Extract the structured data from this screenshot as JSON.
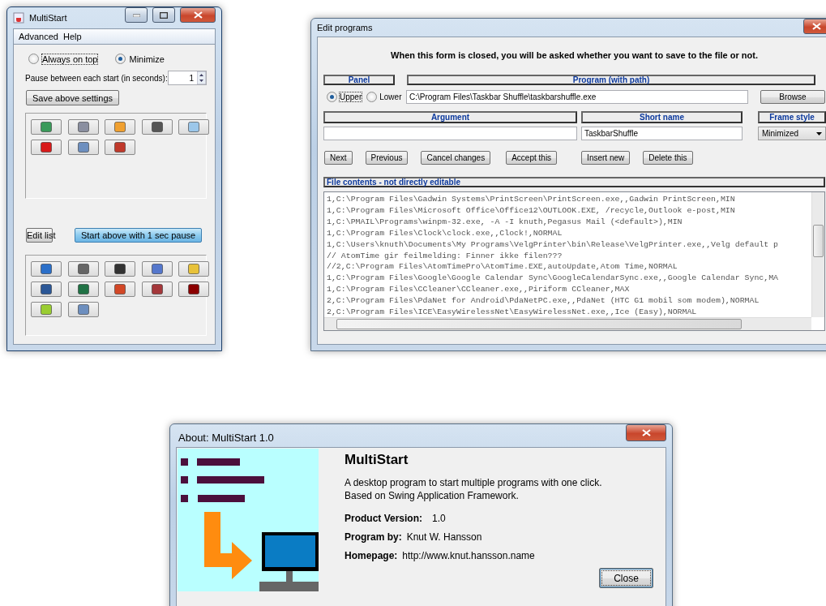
{
  "main_window": {
    "title": "MultiStart",
    "menu": [
      "Advanced",
      "Help"
    ],
    "options": [
      {
        "label": "Always on top",
        "selected": false
      },
      {
        "label": "Minimize",
        "selected": true
      }
    ],
    "pause": {
      "label": "Pause between each start (in seconds):",
      "value": "1"
    },
    "save_button": "Save above settings",
    "upper_panel": [
      {
        "color": "#3a9a5a"
      },
      {
        "color": "#8a8fa0"
      },
      {
        "color": "#f0a030"
      },
      {
        "color": "#555555"
      },
      {
        "color": "#9cc7ea"
      },
      {
        "color": "#d81a1a"
      },
      {
        "color": "#6d8fbf"
      },
      {
        "color": "#c0392b"
      }
    ],
    "edit_button": "Edit list",
    "start_button": "Start above with 1 sec pause",
    "lower_panel": [
      {
        "color": "#2a6fc9"
      },
      {
        "color": "#666666"
      },
      {
        "color": "#333333"
      },
      {
        "color": "#5577cc"
      },
      {
        "color": "#e8c23a"
      },
      {
        "color": "#2b5797"
      },
      {
        "color": "#207245"
      },
      {
        "color": "#d24726"
      },
      {
        "color": "#a4373a"
      },
      {
        "color": "#8b0000"
      },
      {
        "color": "#9acd32"
      },
      {
        "color": "#6d8fbf"
      }
    ]
  },
  "edit_window": {
    "title": "Edit programs",
    "notice": "When this form is closed, you will be asked whether you want to save to the file or not.",
    "panel_label": "Panel",
    "panel_options": [
      {
        "label": "Upper",
        "selected": true
      },
      {
        "label": "Lower",
        "selected": false
      }
    ],
    "program_label": "Program (with path)",
    "program_value": "C:\\Program Files\\Taskbar Shuffle\\taskbarshuffle.exe",
    "browse_button": "Browse",
    "argument_label": "Argument",
    "short_name_label": "Short name",
    "short_name_value": "TaskbarShuffle",
    "frame_style_label": "Frame style",
    "frame_style_value": "Minimized",
    "buttons": [
      "Next",
      "Previous",
      "Cancel changes",
      "Accept this",
      "Insert new",
      "Delete this"
    ],
    "file_label": "File contents - not directly editable",
    "file_lines": [
      "1,C:\\Program Files\\Gadwin Systems\\PrintScreen\\PrintScreen.exe,,Gadwin PrintScreen,MIN",
      "1,C:\\Program Files\\Microsoft Office\\Office12\\OUTLOOK.EXE, /recycle,Outlook e-post,MIN",
      "1,C:\\PMAIL\\Programs\\winpm-32.exe, -A -I knuth,Pegasus Mail (<default>),MIN",
      "1,C:\\Program Files\\Clock\\clock.exe,,Clock!,NORMAL",
      "1,C:\\Users\\knuth\\Documents\\My Programs\\VelgPrinter\\bin\\Release\\VelgPrinter.exe,,Velg default p",
      "// AtomTime gir feilmelding: Finner ikke filen???",
      "//2,C:\\Program Files\\AtomTimePro\\AtomTime.EXE,autoUpdate,Atom Time,NORMAL",
      "1,C:\\Program Files\\Google\\Google Calendar Sync\\GoogleCalendarSync.exe,,Google Calendar Sync,MA",
      "1,C:\\Program Files\\CCleaner\\CCleaner.exe,,Piriform CCleaner,MAX",
      "2,C:\\Program Files\\PdaNet for Android\\PdaNetPC.exe,,PdaNet (HTC G1 mobil som modem),NORMAL",
      "2,C:\\Program Files\\ICE\\EasyWirelessNet\\EasyWirelessNet.exe,,Ice (Easy),NORMAL"
    ]
  },
  "about_window": {
    "title": "About: MultiStart 1.0",
    "app_name": "MultiStart",
    "description": [
      "A desktop program to start multiple programs with one click.",
      "Based on Swing Application Framework."
    ],
    "details": [
      {
        "label": "Product Version:",
        "value": "1.0"
      },
      {
        "label": "Program by:",
        "value": "Knut W. Hansson"
      },
      {
        "label": "Homepage:",
        "value": "http://www.knut.hansson.name"
      }
    ],
    "close_button": "Close"
  }
}
